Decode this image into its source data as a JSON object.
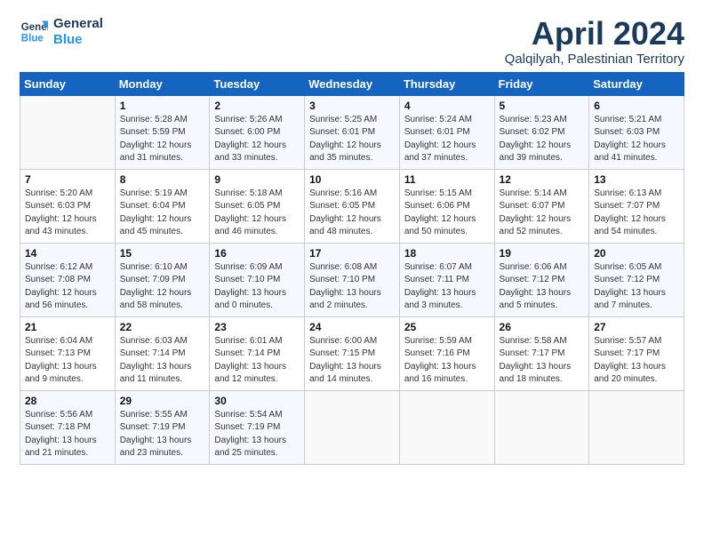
{
  "logo": {
    "line1": "General",
    "line2": "Blue"
  },
  "title": "April 2024",
  "location": "Qalqilyah, Palestinian Territory",
  "days_header": [
    "Sunday",
    "Monday",
    "Tuesday",
    "Wednesday",
    "Thursday",
    "Friday",
    "Saturday"
  ],
  "weeks": [
    [
      {
        "day": "",
        "info": ""
      },
      {
        "day": "1",
        "info": "Sunrise: 5:28 AM\nSunset: 5:59 PM\nDaylight: 12 hours\nand 31 minutes."
      },
      {
        "day": "2",
        "info": "Sunrise: 5:26 AM\nSunset: 6:00 PM\nDaylight: 12 hours\nand 33 minutes."
      },
      {
        "day": "3",
        "info": "Sunrise: 5:25 AM\nSunset: 6:01 PM\nDaylight: 12 hours\nand 35 minutes."
      },
      {
        "day": "4",
        "info": "Sunrise: 5:24 AM\nSunset: 6:01 PM\nDaylight: 12 hours\nand 37 minutes."
      },
      {
        "day": "5",
        "info": "Sunrise: 5:23 AM\nSunset: 6:02 PM\nDaylight: 12 hours\nand 39 minutes."
      },
      {
        "day": "6",
        "info": "Sunrise: 5:21 AM\nSunset: 6:03 PM\nDaylight: 12 hours\nand 41 minutes."
      }
    ],
    [
      {
        "day": "7",
        "info": "Sunrise: 5:20 AM\nSunset: 6:03 PM\nDaylight: 12 hours\nand 43 minutes."
      },
      {
        "day": "8",
        "info": "Sunrise: 5:19 AM\nSunset: 6:04 PM\nDaylight: 12 hours\nand 45 minutes."
      },
      {
        "day": "9",
        "info": "Sunrise: 5:18 AM\nSunset: 6:05 PM\nDaylight: 12 hours\nand 46 minutes."
      },
      {
        "day": "10",
        "info": "Sunrise: 5:16 AM\nSunset: 6:05 PM\nDaylight: 12 hours\nand 48 minutes."
      },
      {
        "day": "11",
        "info": "Sunrise: 5:15 AM\nSunset: 6:06 PM\nDaylight: 12 hours\nand 50 minutes."
      },
      {
        "day": "12",
        "info": "Sunrise: 5:14 AM\nSunset: 6:07 PM\nDaylight: 12 hours\nand 52 minutes."
      },
      {
        "day": "13",
        "info": "Sunrise: 6:13 AM\nSunset: 7:07 PM\nDaylight: 12 hours\nand 54 minutes."
      }
    ],
    [
      {
        "day": "14",
        "info": "Sunrise: 6:12 AM\nSunset: 7:08 PM\nDaylight: 12 hours\nand 56 minutes."
      },
      {
        "day": "15",
        "info": "Sunrise: 6:10 AM\nSunset: 7:09 PM\nDaylight: 12 hours\nand 58 minutes."
      },
      {
        "day": "16",
        "info": "Sunrise: 6:09 AM\nSunset: 7:10 PM\nDaylight: 13 hours\nand 0 minutes."
      },
      {
        "day": "17",
        "info": "Sunrise: 6:08 AM\nSunset: 7:10 PM\nDaylight: 13 hours\nand 2 minutes."
      },
      {
        "day": "18",
        "info": "Sunrise: 6:07 AM\nSunset: 7:11 PM\nDaylight: 13 hours\nand 3 minutes."
      },
      {
        "day": "19",
        "info": "Sunrise: 6:06 AM\nSunset: 7:12 PM\nDaylight: 13 hours\nand 5 minutes."
      },
      {
        "day": "20",
        "info": "Sunrise: 6:05 AM\nSunset: 7:12 PM\nDaylight: 13 hours\nand 7 minutes."
      }
    ],
    [
      {
        "day": "21",
        "info": "Sunrise: 6:04 AM\nSunset: 7:13 PM\nDaylight: 13 hours\nand 9 minutes."
      },
      {
        "day": "22",
        "info": "Sunrise: 6:03 AM\nSunset: 7:14 PM\nDaylight: 13 hours\nand 11 minutes."
      },
      {
        "day": "23",
        "info": "Sunrise: 6:01 AM\nSunset: 7:14 PM\nDaylight: 13 hours\nand 12 minutes."
      },
      {
        "day": "24",
        "info": "Sunrise: 6:00 AM\nSunset: 7:15 PM\nDaylight: 13 hours\nand 14 minutes."
      },
      {
        "day": "25",
        "info": "Sunrise: 5:59 AM\nSunset: 7:16 PM\nDaylight: 13 hours\nand 16 minutes."
      },
      {
        "day": "26",
        "info": "Sunrise: 5:58 AM\nSunset: 7:17 PM\nDaylight: 13 hours\nand 18 minutes."
      },
      {
        "day": "27",
        "info": "Sunrise: 5:57 AM\nSunset: 7:17 PM\nDaylight: 13 hours\nand 20 minutes."
      }
    ],
    [
      {
        "day": "28",
        "info": "Sunrise: 5:56 AM\nSunset: 7:18 PM\nDaylight: 13 hours\nand 21 minutes."
      },
      {
        "day": "29",
        "info": "Sunrise: 5:55 AM\nSunset: 7:19 PM\nDaylight: 13 hours\nand 23 minutes."
      },
      {
        "day": "30",
        "info": "Sunrise: 5:54 AM\nSunset: 7:19 PM\nDaylight: 13 hours\nand 25 minutes."
      },
      {
        "day": "",
        "info": ""
      },
      {
        "day": "",
        "info": ""
      },
      {
        "day": "",
        "info": ""
      },
      {
        "day": "",
        "info": ""
      }
    ]
  ]
}
